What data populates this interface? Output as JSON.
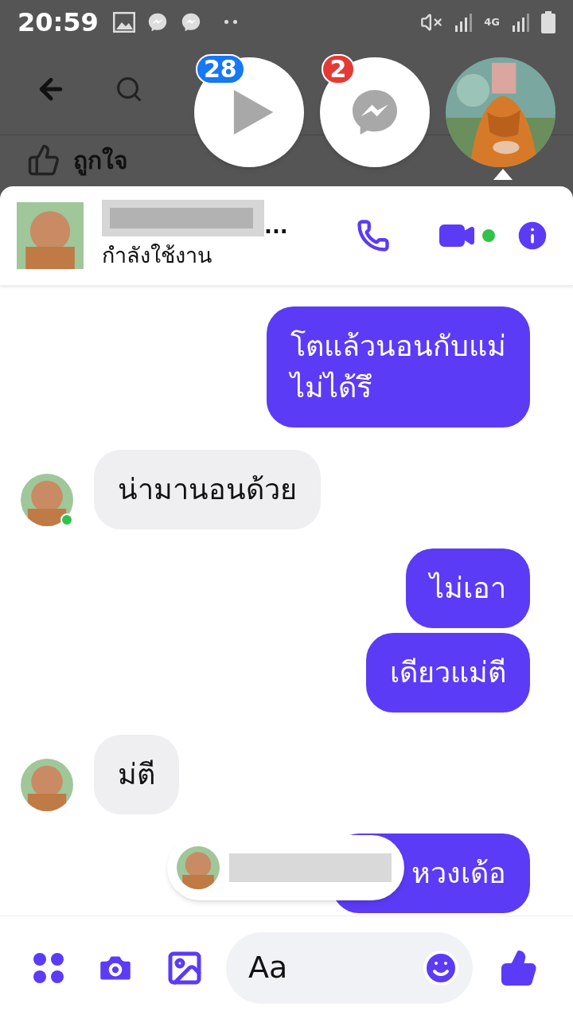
{
  "status_bar": {
    "time": "20:59",
    "network": "4G"
  },
  "background_page": {
    "like": "ถูกใจ"
  },
  "chat_heads": [
    {
      "kind": "video",
      "badge": "28",
      "color": "#1877f2"
    },
    {
      "kind": "messenger",
      "badge": "2",
      "color": "#e53935"
    },
    {
      "kind": "avatar"
    }
  ],
  "chat": {
    "name_suffix": "...",
    "status": "กำลังใช้งาน"
  },
  "messages": [
    {
      "kind": "outgoing",
      "text": "โตแล้วนอนกับแม่\nไม่ได้รึ"
    },
    {
      "kind": "incoming",
      "text": "น่ามานอนด้วย",
      "avatar": true,
      "online": true
    },
    {
      "kind": "outgoing",
      "text": "ไม่เอา"
    },
    {
      "kind": "outgoing",
      "text": "เดียวแม่ตี"
    },
    {
      "kind": "incoming",
      "text": "ม่ตี",
      "avatar": true,
      "online": false
    },
    {
      "kind": "outgoing",
      "text": "หวงเด้อ",
      "covered": true
    }
  ],
  "composer": {
    "placeholder": "Aa"
  }
}
